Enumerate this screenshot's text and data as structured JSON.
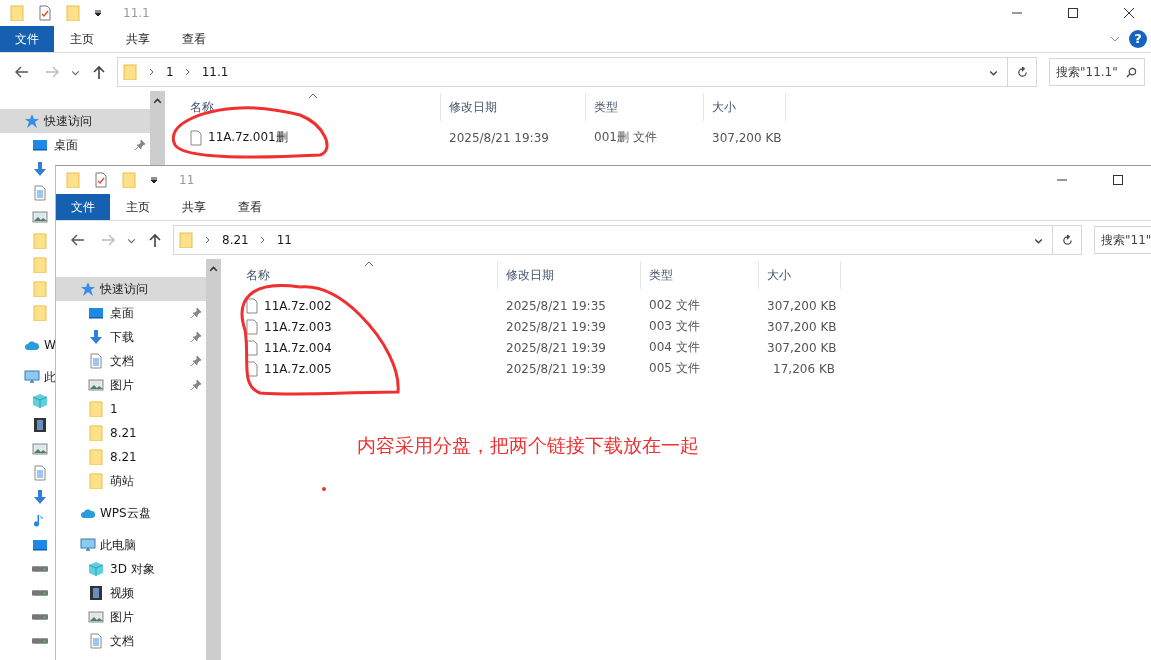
{
  "windows": [
    {
      "title": "11.1",
      "help_label": "?",
      "ribbon_tabs": [
        {
          "label": "文件",
          "selected": true
        },
        {
          "label": "主页",
          "selected": false
        },
        {
          "label": "共享",
          "selected": false
        },
        {
          "label": "查看",
          "selected": false
        }
      ],
      "path": [
        "1",
        "11.1"
      ],
      "search_placeholder": "搜索\"11.1\"",
      "sidebar": [
        {
          "kind": "star",
          "label": "快速访问",
          "pinned": false,
          "selected": true
        },
        {
          "kind": "desktop",
          "label": "桌面",
          "pinned": true,
          "selected": false
        },
        {
          "kind": "download",
          "pinned": false,
          "selected": false
        },
        {
          "kind": "doc",
          "pinned": false,
          "selected": false
        },
        {
          "kind": "picture",
          "pinned": false,
          "selected": false
        },
        {
          "kind": "folder",
          "pinned": false,
          "selected": false
        },
        {
          "kind": "folder",
          "pinned": false,
          "selected": false
        },
        {
          "kind": "folder",
          "pinned": false,
          "selected": false
        },
        {
          "kind": "folder",
          "pinned": false,
          "selected": false
        },
        {
          "kind": "cloud",
          "label": "W",
          "pinned": false,
          "selected": false
        },
        {
          "kind": "pc",
          "label": "此",
          "pinned": false,
          "selected": false
        },
        {
          "kind": "cube",
          "pinned": false,
          "selected": false
        },
        {
          "kind": "video",
          "pinned": false,
          "selected": false
        },
        {
          "kind": "picture",
          "pinned": false,
          "selected": false
        },
        {
          "kind": "doc",
          "pinned": false,
          "selected": false
        },
        {
          "kind": "download",
          "pinned": false,
          "selected": false
        },
        {
          "kind": "music",
          "pinned": false,
          "selected": false
        },
        {
          "kind": "desktop",
          "pinned": false,
          "selected": false
        },
        {
          "kind": "drive",
          "pinned": false,
          "selected": false
        },
        {
          "kind": "drive",
          "pinned": false,
          "selected": false
        },
        {
          "kind": "drive",
          "pinned": false,
          "selected": false
        },
        {
          "kind": "drive",
          "pinned": false,
          "selected": false
        }
      ],
      "columns": [
        "名称",
        "修改日期",
        "类型",
        "大小"
      ],
      "files": [
        {
          "name": "11A.7z.001删",
          "date": "2025/8/21 19:39",
          "type": "001删 文件",
          "size": "307,200 KB"
        }
      ]
    },
    {
      "title": "11",
      "ribbon_tabs": [
        {
          "label": "文件",
          "selected": true
        },
        {
          "label": "主页",
          "selected": false
        },
        {
          "label": "共享",
          "selected": false
        },
        {
          "label": "查看",
          "selected": false
        }
      ],
      "path": [
        "8.21",
        "11"
      ],
      "search_placeholder": "搜索\"11\"",
      "sidebar": [
        {
          "kind": "star",
          "label": "快速访问",
          "pinned": false,
          "selected": true
        },
        {
          "kind": "desktop",
          "label": "桌面",
          "pinned": true,
          "selected": false
        },
        {
          "kind": "download",
          "label": "下载",
          "pinned": true,
          "selected": false
        },
        {
          "kind": "doc",
          "label": "文档",
          "pinned": true,
          "selected": false
        },
        {
          "kind": "picture",
          "label": "图片",
          "pinned": true,
          "selected": false
        },
        {
          "kind": "folder",
          "label": "1",
          "pinned": false,
          "selected": false
        },
        {
          "kind": "folder",
          "label": "8.21",
          "pinned": false,
          "selected": false
        },
        {
          "kind": "folder",
          "label": "8.21",
          "pinned": false,
          "selected": false
        },
        {
          "kind": "folder",
          "label": "萌站",
          "pinned": false,
          "selected": false
        },
        {
          "kind": "cloud",
          "label": "WPS云盘",
          "pinned": false,
          "selected": false
        },
        {
          "kind": "pc",
          "label": "此电脑",
          "pinned": false,
          "selected": false
        },
        {
          "kind": "cube",
          "label": "3D 对象",
          "pinned": false,
          "selected": false
        },
        {
          "kind": "video",
          "label": "视频",
          "pinned": false,
          "selected": false
        },
        {
          "kind": "picture",
          "label": "图片",
          "pinned": false,
          "selected": false
        },
        {
          "kind": "doc",
          "label": "文档",
          "pinned": false,
          "selected": false
        }
      ],
      "columns": [
        "名称",
        "修改日期",
        "类型",
        "大小"
      ],
      "files": [
        {
          "name": "11A.7z.002",
          "date": "2025/8/21 19:35",
          "type": "002 文件",
          "size": "307,200 KB"
        },
        {
          "name": "11A.7z.003",
          "date": "2025/8/21 19:39",
          "type": "003 文件",
          "size": "307,200 KB"
        },
        {
          "name": "11A.7z.004",
          "date": "2025/8/21 19:39",
          "type": "004 文件",
          "size": "307,200 KB"
        },
        {
          "name": "11A.7z.005",
          "date": "2025/8/21 19:39",
          "type": "005 文件",
          "size": "17,206 KB"
        }
      ]
    }
  ],
  "annotation": "内容采用分盘，把两个链接下载放在一起"
}
